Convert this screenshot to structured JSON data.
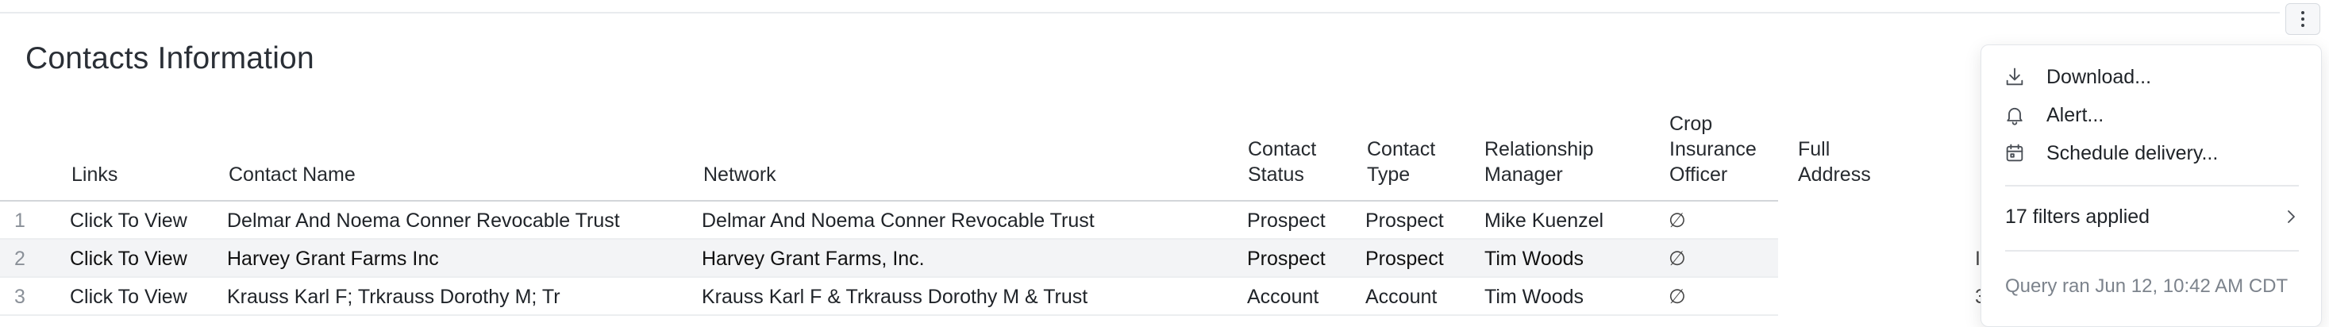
{
  "title": "Contacts Information",
  "toolbar": {
    "more_icon": "kebab-vertical-icon"
  },
  "table": {
    "columns": [
      {
        "key": "links",
        "label": "Links"
      },
      {
        "key": "contact_name",
        "label": "Contact Name"
      },
      {
        "key": "network",
        "label": "Network"
      },
      {
        "key": "contact_status",
        "label": "Contact Status"
      },
      {
        "key": "contact_type",
        "label": "Contact Type"
      },
      {
        "key": "relationship_manager",
        "label": "Relationship Manager"
      },
      {
        "key": "crop_insurance_officer",
        "label": "Crop Insurance Officer"
      },
      {
        "key": "full_address",
        "label": "Full Address"
      }
    ],
    "header_lines": {
      "contact_status": [
        "Contact",
        "Status"
      ],
      "contact_type": [
        "Contact",
        "Type"
      ],
      "relationship_manager": [
        "Relationship",
        "Manager"
      ],
      "crop_insurance_officer": [
        "Crop",
        "Insurance",
        "Officer"
      ]
    },
    "rows": [
      {
        "num": "1",
        "links": "Click To View",
        "contact_name": "Delmar And Noema Conner Revocable Trust",
        "network": "Delmar And Noema Conner Revocable Trust",
        "contact_status": "Prospect",
        "contact_type": "Prospect",
        "relationship_manager": "Mike Kuenzel",
        "crop_insurance_officer": "∅"
      },
      {
        "num": "2",
        "links": "Click To View",
        "contact_name": "Harvey Grant Farms Inc",
        "network": "Harvey Grant Farms, Inc.",
        "contact_status": "Prospect",
        "contact_type": "Prospect",
        "relationship_manager": "Tim Woods",
        "crop_insurance_officer": "∅"
      },
      {
        "num": "3",
        "links": "Click To View",
        "contact_name": "Krauss Karl F; Trkrauss Dorothy M; Tr",
        "network": "Krauss Karl F & Trkrauss Dorothy M & Trust",
        "contact_status": "Account",
        "contact_type": "Account",
        "relationship_manager": "Tim Woods",
        "crop_insurance_officer": "∅"
      }
    ],
    "partial_right": [
      "I",
      "3"
    ]
  },
  "menu": {
    "items": [
      {
        "label": "Download...",
        "icon": "download-icon"
      },
      {
        "label": "Alert...",
        "icon": "bell-icon"
      },
      {
        "label": "Schedule delivery...",
        "icon": "calendar-icon"
      }
    ],
    "filters_label": "17 filters applied",
    "query_info": "Query ran Jun 12, 10:42 AM CDT"
  }
}
